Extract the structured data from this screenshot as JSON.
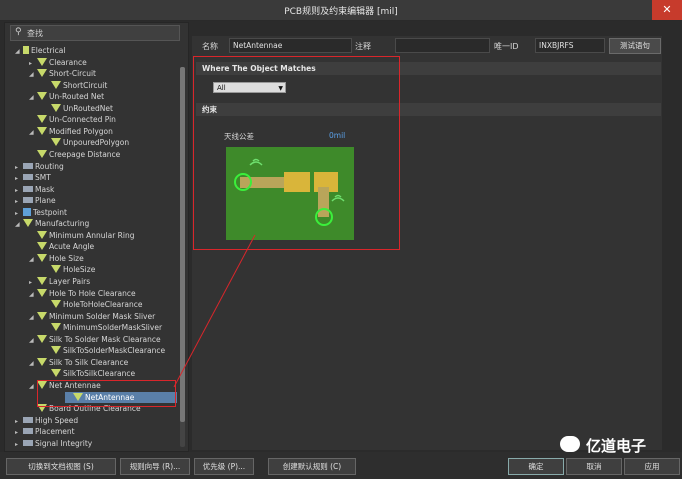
{
  "window": {
    "title": "PCB规则及约束编辑器 [mil]",
    "close_glyph": "✕"
  },
  "search": {
    "placeholder": "查找"
  },
  "tree": [
    {
      "label": "Electrical",
      "arrow": "◢",
      "icon": "doc",
      "indent": 1
    },
    {
      "label": "Clearance",
      "arrow": "▸",
      "icon": "tri",
      "indent": 2
    },
    {
      "label": "Short-Circuit",
      "arrow": "◢",
      "icon": "tri",
      "indent": 2
    },
    {
      "label": "ShortCircuit",
      "arrow": "",
      "icon": "tri",
      "indent": 3
    },
    {
      "label": "Un-Routed Net",
      "arrow": "◢",
      "icon": "tri",
      "indent": 2
    },
    {
      "label": "UnRoutedNet",
      "arrow": "",
      "icon": "tri",
      "indent": 3
    },
    {
      "label": "Un-Connected Pin",
      "arrow": "",
      "icon": "tri",
      "indent": 2
    },
    {
      "label": "Modified Polygon",
      "arrow": "◢",
      "icon": "tri",
      "indent": 2
    },
    {
      "label": "UnpouredPolygon",
      "arrow": "",
      "icon": "tri",
      "indent": 3
    },
    {
      "label": "Creepage Distance",
      "arrow": "",
      "icon": "tri",
      "indent": 2
    },
    {
      "label": "Routing",
      "arrow": "▸",
      "icon": "bar",
      "indent": 1
    },
    {
      "label": "SMT",
      "arrow": "▸",
      "icon": "bar",
      "indent": 1
    },
    {
      "label": "Mask",
      "arrow": "▸",
      "icon": "bar",
      "indent": 1
    },
    {
      "label": "Plane",
      "arrow": "▸",
      "icon": "bar",
      "indent": 1
    },
    {
      "label": "Testpoint",
      "arrow": "▸",
      "icon": "blue",
      "indent": 1
    },
    {
      "label": "Manufacturing",
      "arrow": "◢",
      "icon": "tri",
      "indent": 1
    },
    {
      "label": "Minimum Annular Ring",
      "arrow": "",
      "icon": "tri",
      "indent": 2
    },
    {
      "label": "Acute Angle",
      "arrow": "",
      "icon": "tri",
      "indent": 2
    },
    {
      "label": "Hole Size",
      "arrow": "◢",
      "icon": "tri",
      "indent": 2
    },
    {
      "label": "HoleSize",
      "arrow": "",
      "icon": "tri",
      "indent": 3
    },
    {
      "label": "Layer Pairs",
      "arrow": "▸",
      "icon": "tri",
      "indent": 2
    },
    {
      "label": "Hole To Hole Clearance",
      "arrow": "◢",
      "icon": "tri",
      "indent": 2
    },
    {
      "label": "HoleToHoleClearance",
      "arrow": "",
      "icon": "tri",
      "indent": 3
    },
    {
      "label": "Minimum Solder Mask Sliver",
      "arrow": "◢",
      "icon": "tri",
      "indent": 2
    },
    {
      "label": "MinimumSolderMaskSliver",
      "arrow": "",
      "icon": "tri",
      "indent": 3
    },
    {
      "label": "Silk To Solder Mask Clearance",
      "arrow": "◢",
      "icon": "tri",
      "indent": 2
    },
    {
      "label": "SilkToSolderMaskClearance",
      "arrow": "",
      "icon": "tri",
      "indent": 3
    },
    {
      "label": "Silk To Silk Clearance",
      "arrow": "◢",
      "icon": "tri",
      "indent": 2
    },
    {
      "label": "SilkToSilkClearance",
      "arrow": "",
      "icon": "tri",
      "indent": 3
    },
    {
      "label": "Net Antennae",
      "arrow": "◢",
      "icon": "tri",
      "indent": 2
    },
    {
      "label": "NetAntennae",
      "arrow": "",
      "icon": "tri",
      "indent": 3,
      "selected": true
    },
    {
      "label": "Board Outline Clearance",
      "arrow": "",
      "icon": "tri",
      "indent": 2
    },
    {
      "label": "High Speed",
      "arrow": "▸",
      "icon": "bar",
      "indent": 1
    },
    {
      "label": "Placement",
      "arrow": "▸",
      "icon": "bar",
      "indent": 1
    },
    {
      "label": "Signal Integrity",
      "arrow": "▸",
      "icon": "bar",
      "indent": 1
    }
  ],
  "header": {
    "name_label": "名称",
    "name_value": "NetAntennae",
    "comment_label": "注释",
    "comment_value": "",
    "id_label": "唯一ID",
    "id_value": "INXBJRFS",
    "test_button": "测试语句"
  },
  "match": {
    "title": "Where The Object Matches",
    "scope": "All"
  },
  "constraints": {
    "title": "约束",
    "tolerance_label": "天线公差",
    "tolerance_value": "0mil"
  },
  "footer": {
    "buttons": [
      "切换到文档视图 (S)",
      "规则向导 (R)...",
      "优先级 (P)...",
      "创建默认规则 (C)"
    ],
    "ok": "确定",
    "cancel": "取消",
    "apply": "应用"
  },
  "watermark": {
    "text": "亿道电子"
  },
  "colors": {
    "board": "#3e8a2a",
    "pad": "#d9b53a",
    "highlight": "#d9262b",
    "selected": "#5a7fa8"
  }
}
